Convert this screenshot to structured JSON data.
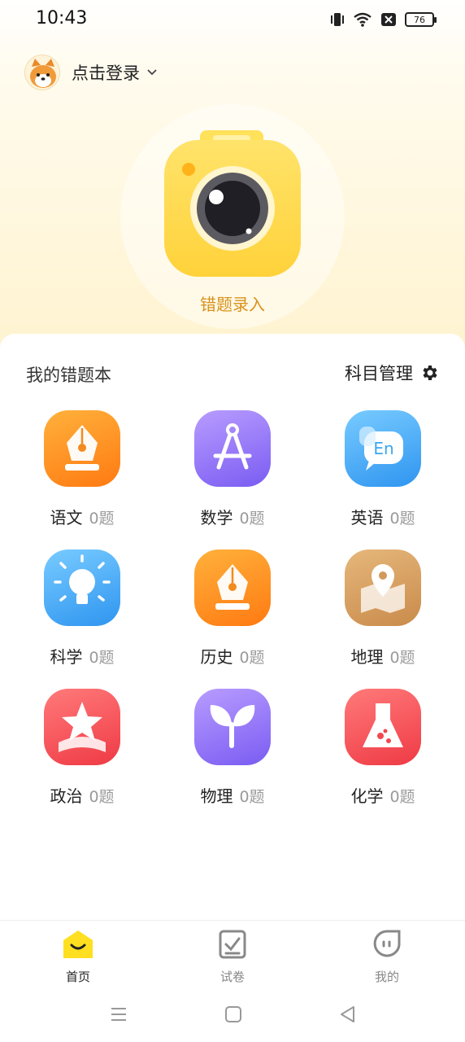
{
  "status": {
    "time": "10:43",
    "battery": "76"
  },
  "header": {
    "login_text": "点击登录"
  },
  "camera": {
    "label": "错题录入"
  },
  "notebook": {
    "title": "我的错题本",
    "manage_label": "科目管理",
    "subjects": [
      {
        "name": "语文",
        "count": "0题",
        "icon": "pen-nib-icon",
        "color": "#ff8a1c"
      },
      {
        "name": "数学",
        "count": "0题",
        "icon": "compass-icon",
        "color": "#8b6cf0"
      },
      {
        "name": "英语",
        "count": "0题",
        "icon": "en-speech-bubble-icon",
        "color": "#3aa7f2"
      },
      {
        "name": "科学",
        "count": "0题",
        "icon": "lightbulb-icon",
        "color": "#3aa7f2"
      },
      {
        "name": "历史",
        "count": "0题",
        "icon": "pen-nib-icon",
        "color": "#ff8a1c"
      },
      {
        "name": "地理",
        "count": "0题",
        "icon": "map-pin-icon",
        "color": "#d19a5c"
      },
      {
        "name": "政治",
        "count": "0题",
        "icon": "star-icon",
        "color": "#f2484f"
      },
      {
        "name": "物理",
        "count": "0题",
        "icon": "sprout-icon",
        "color": "#8b6cf0"
      },
      {
        "name": "化学",
        "count": "0题",
        "icon": "flask-icon",
        "color": "#f2484f"
      }
    ]
  },
  "nav": {
    "items": [
      {
        "label": "首页",
        "icon": "home-icon",
        "active": true
      },
      {
        "label": "试卷",
        "icon": "paper-check-icon",
        "active": false
      },
      {
        "label": "我的",
        "icon": "profile-face-icon",
        "active": false
      }
    ]
  }
}
